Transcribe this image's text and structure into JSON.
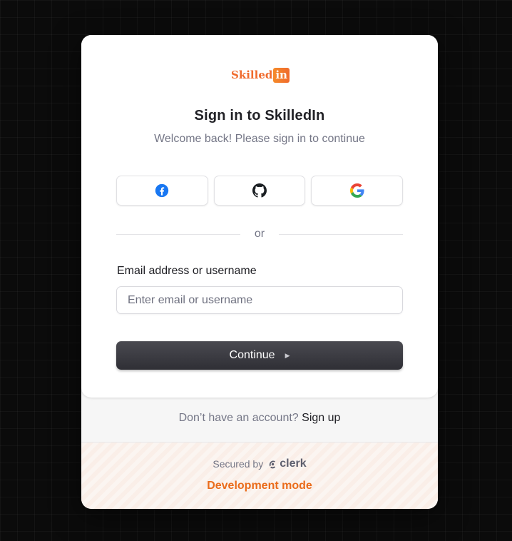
{
  "brand": {
    "logo_text_1": "Skilled",
    "logo_text_2": "in",
    "logo_color": "#f06a2c"
  },
  "header": {
    "title": "Sign in to SkilledIn",
    "subtitle": "Welcome back! Please sign in to continue"
  },
  "social": [
    {
      "name": "facebook",
      "icon": "facebook-icon",
      "color": "#1877f2"
    },
    {
      "name": "github",
      "icon": "github-icon",
      "color": "#1b1f23"
    },
    {
      "name": "google",
      "icon": "google-icon",
      "color": "#4285f4"
    }
  ],
  "divider": {
    "label": "or"
  },
  "form": {
    "email_label": "Email address or username",
    "email_placeholder": "Enter email or username",
    "email_value": "",
    "continue_label": "Continue"
  },
  "footer": {
    "signup_prompt": "Don’t have an account?",
    "signup_link": "Sign up",
    "secured_by": "Secured by",
    "provider": "clerk",
    "dev_mode": "Development mode",
    "dev_mode_color": "#ea6c1b"
  }
}
